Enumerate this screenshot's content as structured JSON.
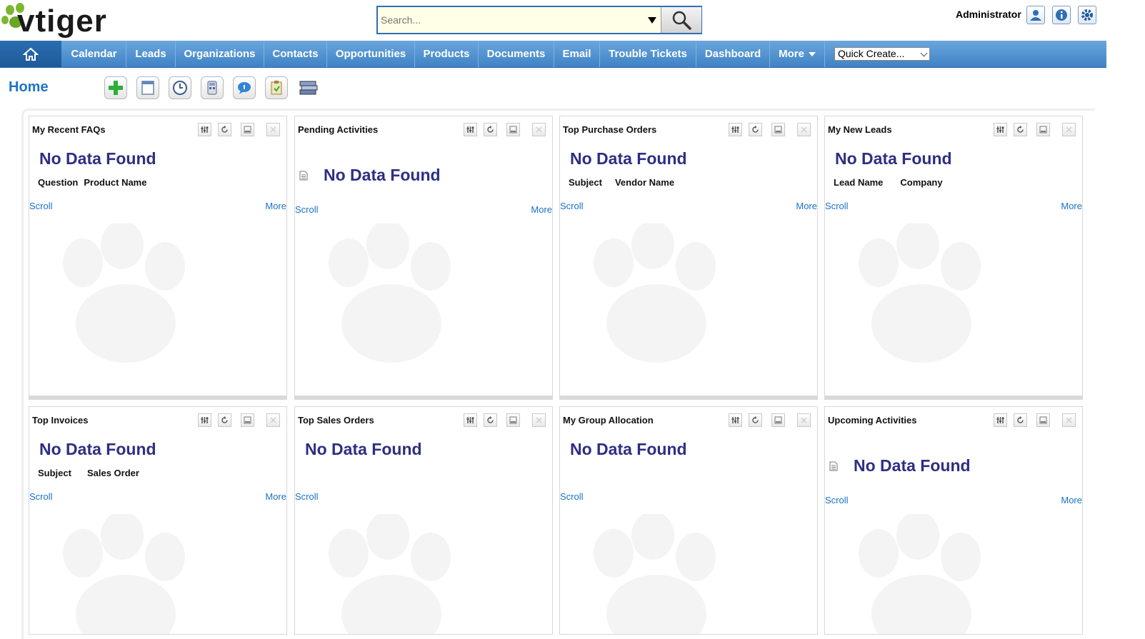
{
  "header": {
    "logo_text": "vtiger",
    "search_placeholder": "Search...",
    "user_name": "Administrator",
    "icons": [
      "user-profile-icon",
      "info-icon",
      "settings-icon"
    ]
  },
  "nav": {
    "home_icon": "home-icon",
    "items": [
      "Calendar",
      "Leads",
      "Organizations",
      "Contacts",
      "Opportunities",
      "Products",
      "Documents",
      "Email",
      "Trouble Tickets",
      "Dashboard",
      "More"
    ],
    "quick_create": "Quick Create..."
  },
  "page": {
    "title": "Home",
    "toolbar_icons": [
      "add-widget-icon",
      "notebook-icon",
      "clock-icon",
      "calculator-icon",
      "chat-icon",
      "clipboard-icon",
      "stack-icon"
    ]
  },
  "widgets": [
    {
      "title": "My Recent FAQs",
      "no_data": "No Data Found",
      "cols": [
        "Question",
        "Product Name"
      ],
      "scroll": "Scroll",
      "more": "More"
    },
    {
      "title": "Pending Activities",
      "no_data": "No Data Found",
      "cols": [],
      "scroll": "Scroll",
      "more": "More"
    },
    {
      "title": "Top Purchase Orders",
      "no_data": "No Data Found",
      "cols": [
        "Subject",
        "Vendor Name"
      ],
      "scroll": "Scroll",
      "more": "More"
    },
    {
      "title": "My New Leads",
      "no_data": "No Data Found",
      "cols": [
        "Lead Name",
        "Company"
      ],
      "scroll": "Scroll",
      "more": "More"
    },
    {
      "title": "Top Invoices",
      "no_data": "No Data Found",
      "cols": [
        "Subject",
        "Sales Order"
      ],
      "scroll": "Scroll",
      "more": "More"
    },
    {
      "title": "Top Sales Orders",
      "no_data": "No Data Found",
      "cols": [],
      "scroll": "Scroll",
      "more": ""
    },
    {
      "title": "My Group Allocation",
      "no_data": "No Data Found",
      "cols": [],
      "scroll": "Scroll",
      "more": ""
    },
    {
      "title": "Upcoming Activities",
      "no_data": "No Data Found",
      "cols": [],
      "scroll": "Scroll",
      "more": "More"
    }
  ],
  "colors": {
    "nav_bg": "#4a8fd0",
    "nav_home_bg": "#2463a5",
    "title_blue": "#1f74c5",
    "no_data": "#2e2e84",
    "link": "#1a73c9"
  }
}
